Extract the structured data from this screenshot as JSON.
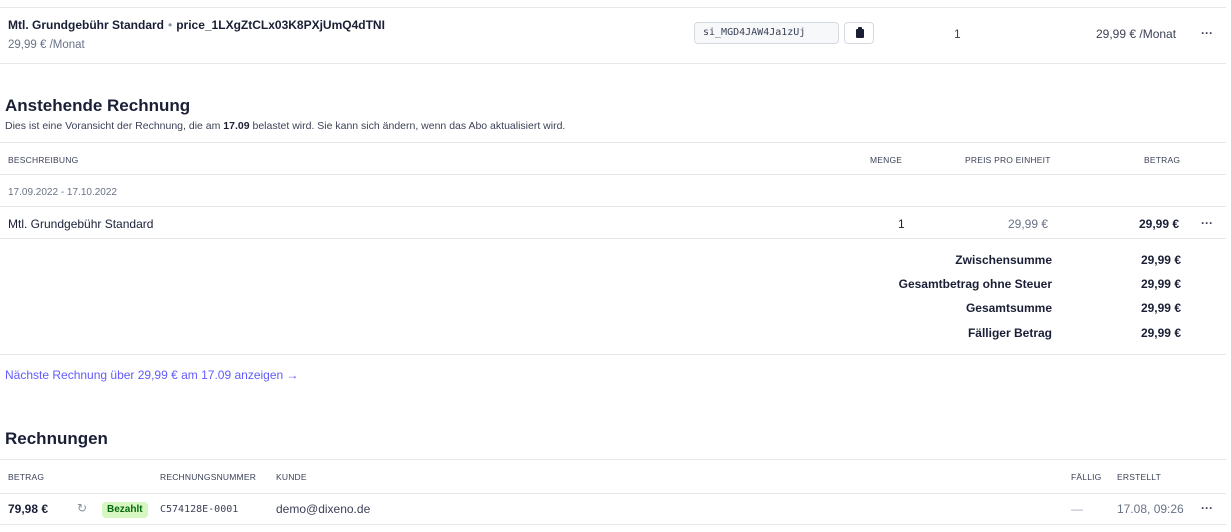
{
  "subscription_item": {
    "product_name": "Mtl. Grundgebühr Standard",
    "separator": "•",
    "price_id": "price_1LXgZtCLx03K8PXjUmQ4dTNI",
    "price_summary": "29,99 € /Monat",
    "item_id": "si_MGD4JAW4Ja1zUj",
    "copy_icon": "clipboard-icon",
    "quantity": "1",
    "price": "29,99 € /Monat",
    "more_label": "···"
  },
  "upcoming_invoice": {
    "title": "Anstehende Rechnung",
    "description_before": "Dies ist eine Voransicht der Rechnung, die am ",
    "description_date": "17.09",
    "description_after": " belastet wird. Sie kann sich ändern, wenn das Abo aktualisiert wird.",
    "columns": {
      "description": "BESCHREIBUNG",
      "quantity": "MENGE",
      "unit_price": "PREIS PRO EINHEIT",
      "amount": "BETRAG"
    },
    "period": "17.09.2022 - 17.10.2022",
    "line": {
      "description": "Mtl. Grundgebühr Standard",
      "quantity": "1",
      "unit_price": "29,99 €",
      "amount": "29,99 €",
      "more_label": "···"
    },
    "totals": [
      {
        "label": "Zwischensumme",
        "value": "29,99 €"
      },
      {
        "label": "Gesamtbetrag ohne Steuer",
        "value": "29,99 €"
      },
      {
        "label": "Gesamtsumme",
        "value": "29,99 €"
      },
      {
        "label": "Fälliger Betrag",
        "value": "29,99 €"
      }
    ],
    "next_link": "Nächste Rechnung über 29,99 € am 17.09 anzeigen →"
  },
  "invoices": {
    "title": "Rechnungen",
    "columns": {
      "amount": "BETRAG",
      "number": "RECHNUNGSNUMMER",
      "customer": "KUNDE",
      "due": "FÄLLIG",
      "created": "ERSTELLT"
    },
    "rows": [
      {
        "amount": "79,98 €",
        "sync_icon": "refresh-icon",
        "status": "Bezahlt",
        "number": "C574128E-0001",
        "customer": "demo@dixeno.de",
        "due": "—",
        "created": "17.08, 09:26",
        "more_label": "···"
      }
    ]
  },
  "colors": {
    "text": "#1a1f36",
    "muted": "#697386",
    "link": "#635bff",
    "border": "#e6e8ec",
    "badge_bg": "#d7f7c2",
    "badge_text": "#05690d"
  }
}
